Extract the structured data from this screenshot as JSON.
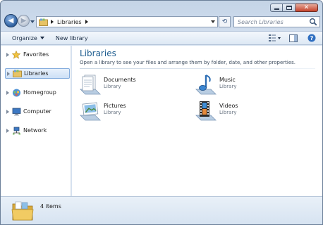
{
  "window": {
    "caption_buttons": [
      "minimize",
      "maximize",
      "close"
    ]
  },
  "address": {
    "crumbs": [
      "Libraries"
    ]
  },
  "search": {
    "placeholder": "Search Libraries"
  },
  "toolbar": {
    "organize_label": "Organize",
    "new_library_label": "New library"
  },
  "nav": {
    "items": [
      {
        "label": "Favorites",
        "icon": "star-icon"
      },
      {
        "label": "Libraries",
        "icon": "libraries-icon",
        "selected": true
      },
      {
        "label": "Homegroup",
        "icon": "homegroup-icon"
      },
      {
        "label": "Computer",
        "icon": "computer-icon"
      },
      {
        "label": "Network",
        "icon": "network-icon"
      }
    ]
  },
  "main": {
    "title": "Libraries",
    "description": "Open a library to see your files and arrange them by folder, date, and other properties.",
    "libraries": [
      {
        "name": "Documents",
        "type": "Library",
        "icon": "documents-icon"
      },
      {
        "name": "Music",
        "type": "Library",
        "icon": "music-icon"
      },
      {
        "name": "Pictures",
        "type": "Library",
        "icon": "pictures-icon"
      },
      {
        "name": "Videos",
        "type": "Library",
        "icon": "videos-icon"
      }
    ]
  },
  "details": {
    "count": "4 items"
  },
  "colors": {
    "title_blue": "#1e5d8f",
    "chrome": "#c9d8ea",
    "selection": "#cde0f6"
  }
}
